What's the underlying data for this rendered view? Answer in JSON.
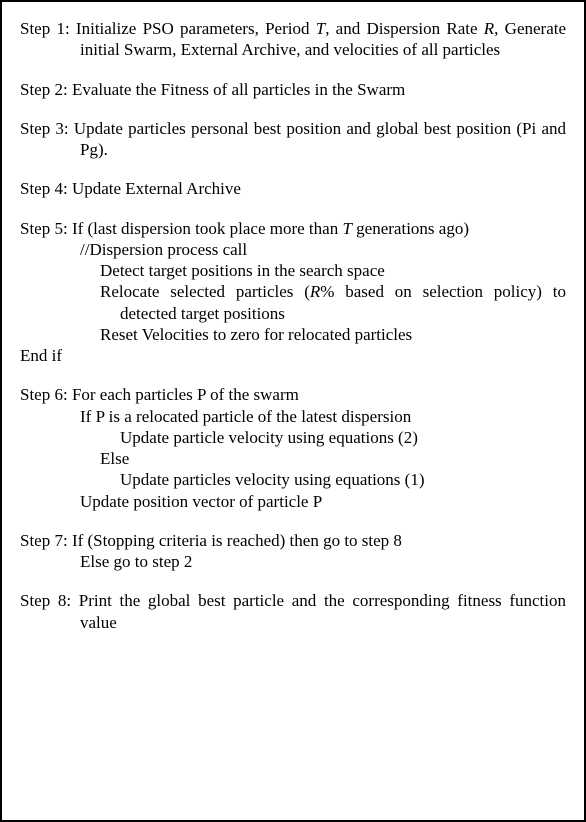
{
  "step1": {
    "lead_a": "Step 1: Initialize PSO parameters, Period ",
    "T": "T",
    "lead_b": ", and Dispersion Rate ",
    "R": "R",
    "lead_c": ", Generate initial Swarm, External Archive, and velocities of all particles"
  },
  "step2": {
    "lead": "Step 2: Evaluate the Fitness of all particles in the Swarm"
  },
  "step3": {
    "lead": "Step 3: Update particles personal best position and global best position (Pi and Pg)."
  },
  "step4": {
    "lead": "Step 4: Update External Archive"
  },
  "step5": {
    "lead_a": "Step 5: If (last dispersion took place more than ",
    "T": "T",
    "lead_b": " generations ago)",
    "s1": "//Dispersion process call",
    "s2": "Detect target positions in the search space",
    "s3a": "Relocate selected particles (",
    "R": "R",
    "s3b": "% based on selection policy) to detected target positions",
    "s4": "Reset Velocities to zero for relocated particles",
    "end": "End if"
  },
  "step6": {
    "lead": "Step 6: For each particles P of the swarm",
    "s1": "If P is a relocated particle of the latest dispersion",
    "s2": "Update particle velocity using equations (2)",
    "s3": "Else",
    "s4": "Update particles velocity using equations (1)",
    "s5": "Update position vector of particle P"
  },
  "step7": {
    "lead": "Step 7: If (Stopping criteria is reached) then go to step 8",
    "s1": "Else go to step 2"
  },
  "step8": {
    "lead": "Step 8: Print the global best particle and the corresponding fitness function value"
  }
}
